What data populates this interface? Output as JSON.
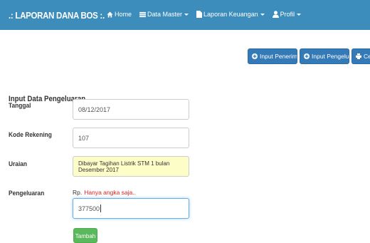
{
  "navbar": {
    "brand": ".: LAPORAN DANA BOS :.",
    "items": [
      {
        "label": "Home",
        "icon": "home-icon"
      },
      {
        "label": "Data Master",
        "icon": "list-icon",
        "dropdown": true
      },
      {
        "label": "Laporan Keuangan",
        "icon": "file-icon",
        "dropdown": true
      },
      {
        "label": "Profil",
        "icon": "user-icon",
        "dropdown": true
      }
    ],
    "colors": {
      "background": "#3c8dbc",
      "text": "#ffffff"
    }
  },
  "toolbar": {
    "input_penerimaan": "Input Penerimaan",
    "input_pengeluaran": "Input Pengeluaran",
    "cetak": "Cetak"
  },
  "form": {
    "title": "Input Data Pengeluaran",
    "tanggal": {
      "label": "Tanggal",
      "value": "08/12/2017"
    },
    "kode_rekening": {
      "label": "Kode Rekening",
      "value": "107"
    },
    "uraian": {
      "label": "Uraian",
      "value": "Dibayar Tagihan Listrik STM 1 bulan Desember 2017"
    },
    "pengeluaran": {
      "label": "Pengeluaran",
      "prefix": "Rp.",
      "hint": "Hanya angka saja..",
      "value": "377500"
    },
    "submit_label": "Tambah"
  },
  "colors": {
    "primary_button": "#337ab7",
    "success_button": "#5cb85c",
    "filled_input": "#fdfdc8",
    "error_text": "#e01e1e"
  }
}
